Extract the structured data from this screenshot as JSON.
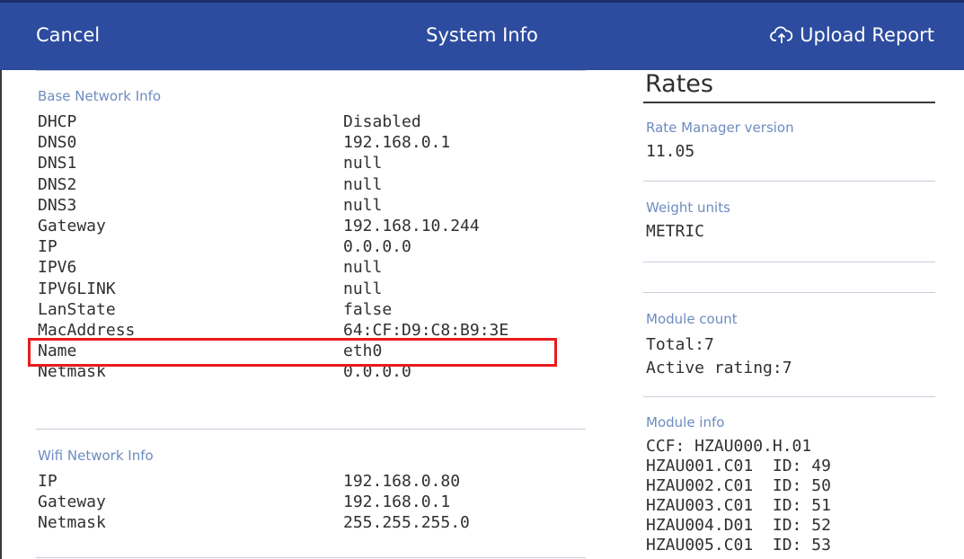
{
  "header": {
    "cancel_label": "Cancel",
    "title": "System Info",
    "upload_label": "Upload Report",
    "upload_icon": "cloud-upload-icon",
    "background_color": "#2d4c9f"
  },
  "base_network": {
    "label": "Base Network Info",
    "rows": [
      {
        "key": "DHCP",
        "value": "Disabled"
      },
      {
        "key": "DNS0",
        "value": "192.168.0.1"
      },
      {
        "key": "DNS1",
        "value": "null"
      },
      {
        "key": "DNS2",
        "value": "null"
      },
      {
        "key": "DNS3",
        "value": "null"
      },
      {
        "key": "Gateway",
        "value": "192.168.10.244"
      },
      {
        "key": "IP",
        "value": "0.0.0.0"
      },
      {
        "key": "IPV6",
        "value": "null"
      },
      {
        "key": "IPV6LINK",
        "value": "null"
      },
      {
        "key": "LanState",
        "value": "false"
      },
      {
        "key": "MacAddress",
        "value": "64:CF:D9:C8:B9:3E"
      },
      {
        "key": "Name",
        "value": "eth0"
      },
      {
        "key": "Netmask",
        "value": "0.0.0.0"
      }
    ]
  },
  "wifi_network": {
    "label": "Wifi Network Info",
    "rows": [
      {
        "key": "IP",
        "value": "192.168.0.80"
      },
      {
        "key": "Gateway",
        "value": "192.168.0.1"
      },
      {
        "key": "Netmask",
        "value": "255.255.255.0"
      }
    ]
  },
  "highlight_color": "#e81c1c",
  "rates": {
    "title": "Rates",
    "rate_manager": {
      "label": "Rate Manager version",
      "value": "11.05"
    },
    "weight_units": {
      "label": "Weight units",
      "value": "METRIC"
    },
    "module_count": {
      "label": "Module count",
      "total": "Total:7",
      "active": "Active rating:7"
    },
    "module_info": {
      "label": "Module info",
      "lines": [
        "CCF: HZAU000.H.01",
        "HZAU001.C01  ID: 49",
        "HZAU002.C01  ID: 50",
        "HZAU003.C01  ID: 51",
        "HZAU004.D01  ID: 52",
        "HZAU005.C01  ID: 53"
      ]
    }
  }
}
